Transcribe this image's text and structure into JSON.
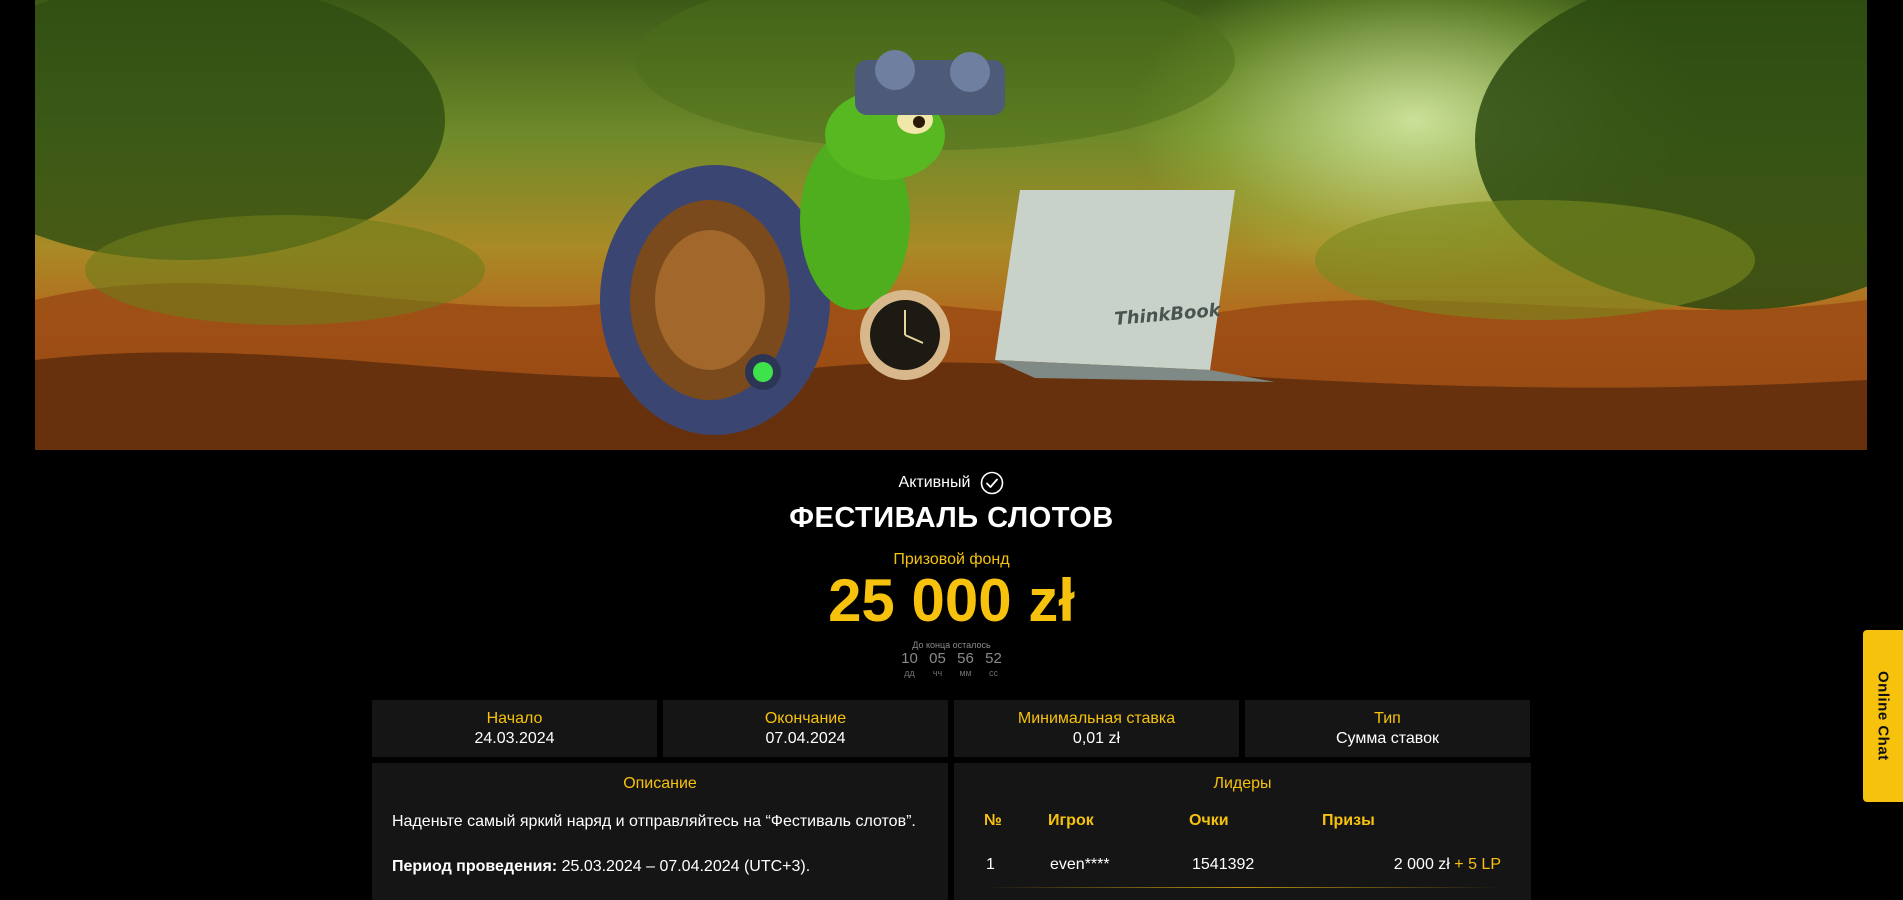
{
  "tournament": {
    "status": "Активный",
    "title": "ФЕСТИВАЛЬ СЛОТОВ",
    "prize_label": "Призовой фонд",
    "prize_amount": "25 000 zł",
    "countdown_label": "До конца осталось",
    "countdown": [
      {
        "value": "10",
        "unit": "дд"
      },
      {
        "value": "05",
        "unit": "чч"
      },
      {
        "value": "56",
        "unit": "мм"
      },
      {
        "value": "52",
        "unit": "сс"
      }
    ]
  },
  "info": {
    "start": {
      "label": "Начало",
      "value": "24.03.2024"
    },
    "end": {
      "label": "Окончание",
      "value": "07.04.2024"
    },
    "min_bet": {
      "label": "Минимальная ставка",
      "value": "0,01 zł"
    },
    "type": {
      "label": "Тип",
      "value": "Сумма ставок"
    }
  },
  "description": {
    "title": "Описание",
    "text": "Наденьте самый яркий наряд и отправляйтесь на “Фестиваль слотов”.",
    "period_label": "Период проведения:",
    "period_value": " 25.03.2024 – 07.04.2024 (UTC+3)."
  },
  "leaders": {
    "title": "Лидеры",
    "headers": {
      "num": "№",
      "player": "Игрок",
      "points": "Очки",
      "prizes": "Призы"
    },
    "rows": [
      {
        "num": "1",
        "player": "even****",
        "points": "1541392",
        "prize": "2 000 zł",
        "lp": "+ 5 LP"
      }
    ]
  },
  "chat": {
    "label": "Online Chat"
  },
  "banner": {
    "laptop_brand": "ThinkBook"
  },
  "colors": {
    "accent": "#f6c20d",
    "panel": "#151515",
    "background": "#000000"
  }
}
